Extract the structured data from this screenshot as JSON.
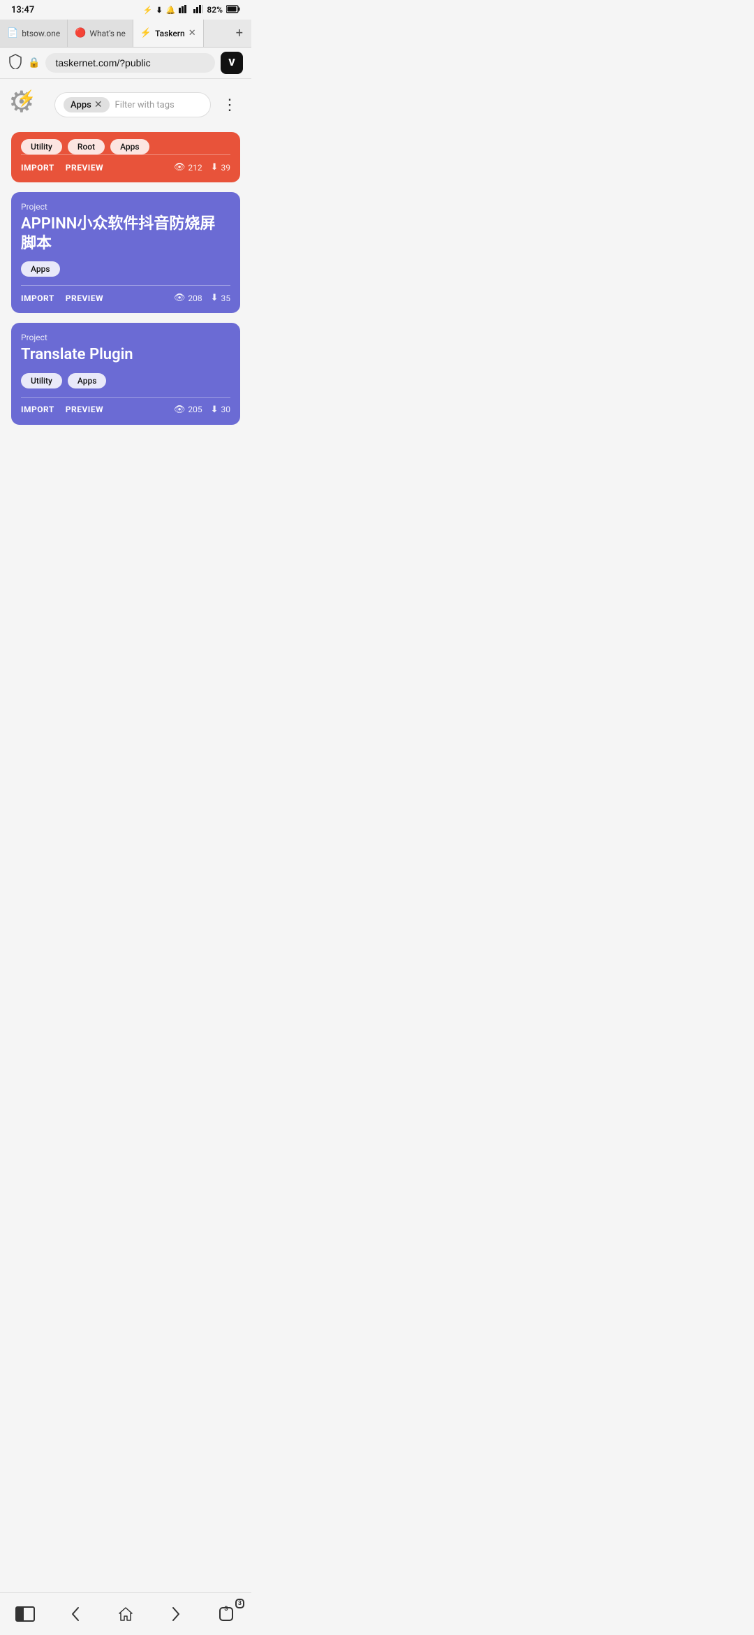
{
  "statusBar": {
    "time": "13:47",
    "battery": "82%"
  },
  "tabs": [
    {
      "id": "tab1",
      "label": "btsow.one",
      "icon": "📄",
      "active": false
    },
    {
      "id": "tab2",
      "label": "What's ne",
      "icon": "🔴",
      "active": false
    },
    {
      "id": "tab3",
      "label": "Taskern",
      "icon": "⚡",
      "active": true,
      "closable": true
    }
  ],
  "tabAdd": "+",
  "addressBar": {
    "url": "taskernet.com/?public"
  },
  "filterBar": {
    "activeTag": "Apps",
    "placeholder": "Filter with tags"
  },
  "moreMenu": "⋮",
  "partialCard": {
    "tags": [
      "Utility",
      "Root",
      "Apps"
    ],
    "actions": [
      "IMPORT",
      "PREVIEW"
    ],
    "views": "212",
    "downloads": "39"
  },
  "cards": [
    {
      "type": "Project",
      "title": "APPINN小众软件抖音防烧屏脚本",
      "tags": [
        "Apps"
      ],
      "actions": [
        "IMPORT",
        "PREVIEW"
      ],
      "views": "208",
      "downloads": "35",
      "color": "purple"
    },
    {
      "type": "Project",
      "title": "Translate Plugin",
      "tags": [
        "Utility",
        "Apps"
      ],
      "actions": [
        "IMPORT",
        "PREVIEW"
      ],
      "views": "205",
      "downloads": "30",
      "color": "purple"
    }
  ],
  "bottomNav": {
    "back": "‹",
    "home": "⌂",
    "forward": "›",
    "tabs": "3"
  }
}
